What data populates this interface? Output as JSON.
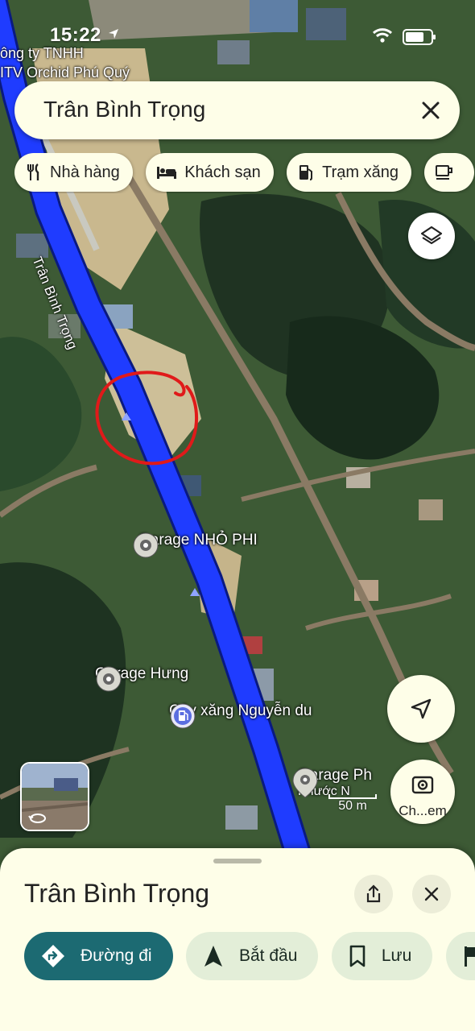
{
  "status_bar": {
    "time": "15:22"
  },
  "search": {
    "query": "Trân Bình Trọng"
  },
  "chips": [
    {
      "icon": "restaurant-icon",
      "label": "Nhà hàng"
    },
    {
      "icon": "hotel-icon",
      "label": "Khách sạn"
    },
    {
      "icon": "gas-station-icon",
      "label": "Trạm xăng"
    },
    {
      "icon": "cafe-icon",
      "label": ""
    }
  ],
  "map": {
    "labels": {
      "company_line1": "ông ty TNHH",
      "company_line2": "ITV Orchid Phú Quý",
      "road_name": "Trân Bình Trọng"
    },
    "pois": {
      "garage_nho_phi": "Garage NHỎ PHI",
      "garage_hung": "Garage Hưng",
      "cay_xang": "Cây xăng Nguyễn du",
      "garage_ph": "Garage Ph",
      "phuoc": "Phước N"
    },
    "scale_label": "50 m",
    "lens_label": "Ch...em",
    "colors": {
      "route": "#1f3cff",
      "annotation": "#e01a1a",
      "poi_pin": "#f2f2ee",
      "gas_pin": "#5b6ee0"
    }
  },
  "sheet": {
    "title": "Trân Bình Trọng",
    "actions": [
      {
        "icon": "directions-icon",
        "label": "Đường đi",
        "primary": true
      },
      {
        "icon": "start-navigation-icon",
        "label": "Bắt đầu",
        "primary": false
      },
      {
        "icon": "bookmark-icon",
        "label": "Lưu",
        "primary": false
      },
      {
        "icon": "flag-icon",
        "label": "",
        "primary": false
      }
    ]
  }
}
